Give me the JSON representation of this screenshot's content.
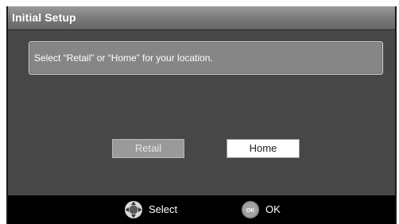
{
  "window": {
    "title": "Initial Setup"
  },
  "message": {
    "text": "Select “Retail” or “Home” for your location."
  },
  "options": [
    {
      "label": "Retail",
      "selected": false
    },
    {
      "label": "Home",
      "selected": true
    }
  ],
  "footer": {
    "select_label": "Select",
    "select_icon": "dpad-icon",
    "ok_label": "OK",
    "ok_icon": "ok-button-icon",
    "ok_icon_text": "OK"
  }
}
